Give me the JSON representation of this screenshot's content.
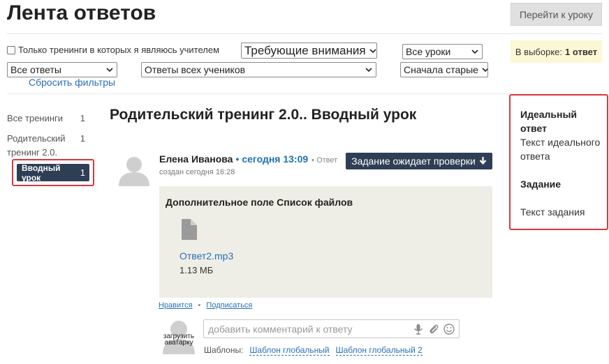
{
  "header": {
    "title": "Лента ответов",
    "goto_lesson_label": "Перейти к уроку"
  },
  "filters": {
    "only_teacher_label": "Только тренинги в которых я являюсь учителем",
    "only_teacher_checked": false,
    "attention_select": "Требующие внимания",
    "lessons_select": "Все уроки",
    "answers_select": "Все ответы",
    "students_select": "Ответы всех учеников",
    "order_select": "Сначала старые",
    "reset_label": "Сбросить фильтры"
  },
  "selection": {
    "label": "В выборке:",
    "count": "1 ответ"
  },
  "sidebar": {
    "all_trainings": {
      "label": "Все тренинги",
      "count": "1"
    },
    "training": {
      "label": "Родительский тренинг 2.0.",
      "count": "1"
    },
    "lesson": {
      "label": "Вводный урок",
      "count": "1"
    }
  },
  "main": {
    "training_title": "Родительский тренинг 2.0.. Вводный урок",
    "answer": {
      "author": "Елена Иванова",
      "separator": "•",
      "time": "сегодня 13:09",
      "kind": "Ответ",
      "created": "создан сегодня 16:28",
      "status_button": "Задание ожидает проверки",
      "field_title": "Дополнительное поле Список файлов",
      "file_name": "Ответ2.mp3",
      "file_size": "1.13 МБ",
      "like_label": "Нравится",
      "actions_separator": "•",
      "subscribe_label": "Подписаться"
    },
    "comment": {
      "avatar_upload_label": "загрузить аватарку",
      "placeholder": "добавить комментарий к ответу",
      "templates_label": "Шаблоны:",
      "templates": [
        "Шаблон глобальный",
        "Шаблон глобальный 2"
      ]
    }
  },
  "right_panel": {
    "ideal_answer_heading": "Идеальный ответ",
    "ideal_answer_text": "Текст идеального ответа",
    "task_heading": "Задание",
    "task_text": "Текст задания"
  },
  "colors": {
    "accent_dark": "#2e3f55",
    "link": "#2a6fb5",
    "highlight_border": "#d9393f",
    "selection_bg": "#fcf8d6",
    "field_bg": "#efeee6"
  },
  "icons": [
    "chevron-down-icon",
    "user-avatar-icon",
    "file-icon",
    "download-icon",
    "microphone-icon",
    "paperclip-icon",
    "smiley-icon"
  ]
}
